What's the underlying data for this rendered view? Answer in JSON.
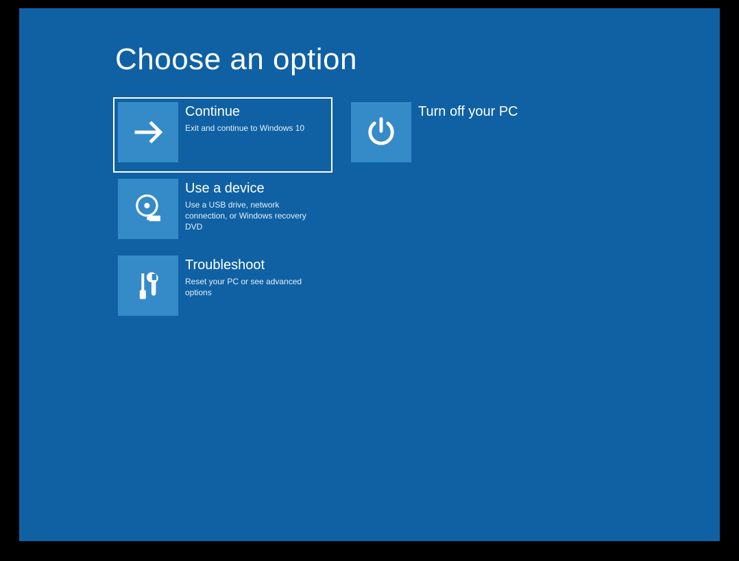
{
  "page": {
    "title": "Choose an option"
  },
  "options": {
    "continue": {
      "title": "Continue",
      "description": "Exit and continue to Windows 10"
    },
    "turnoff": {
      "title": "Turn off your PC",
      "description": ""
    },
    "device": {
      "title": "Use a device",
      "description": "Use a USB drive, network connection, or Windows recovery DVD"
    },
    "troubleshoot": {
      "title": "Troubleshoot",
      "description": "Reset your PC or see advanced options"
    }
  }
}
